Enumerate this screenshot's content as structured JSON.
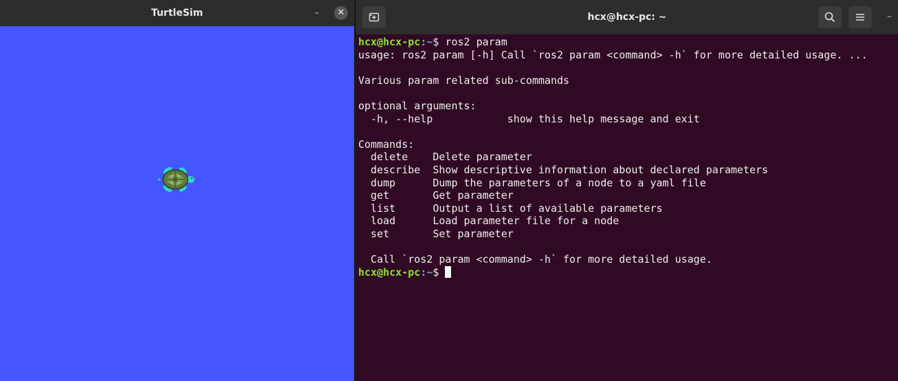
{
  "turtlesim": {
    "title": "TurtleSim",
    "minimize_glyph": "–",
    "close_glyph": "✕",
    "background_color": "#4556ff"
  },
  "terminal": {
    "title": "hcx@hcx-pc: ~",
    "minimize_glyph": "–",
    "background_color": "#300a24",
    "prompt": {
      "user_host": "hcx@hcx-pc",
      "path": ":~",
      "symbol": "$ "
    },
    "command": "ros2 param",
    "output_lines": [
      "usage: ros2 param [-h] Call `ros2 param <command> -h` for more detailed usage. ...",
      "",
      "Various param related sub-commands",
      "",
      "optional arguments:",
      "  -h, --help            show this help message and exit",
      "",
      "Commands:",
      "  delete    Delete parameter",
      "  describe  Show descriptive information about declared parameters",
      "  dump      Dump the parameters of a node to a yaml file",
      "  get       Get parameter",
      "  list      Output a list of available parameters",
      "  load      Load parameter file for a node",
      "  set       Set parameter",
      "",
      "  Call `ros2 param <command> -h` for more detailed usage."
    ]
  },
  "icons": [
    "new-tab-icon",
    "search-icon",
    "hamburger-menu-icon",
    "turtle-icon",
    "close-icon"
  ],
  "colors": {
    "prompt_user": "#8ae234",
    "prompt_path": "#729fcf",
    "text": "#eeeeec"
  }
}
